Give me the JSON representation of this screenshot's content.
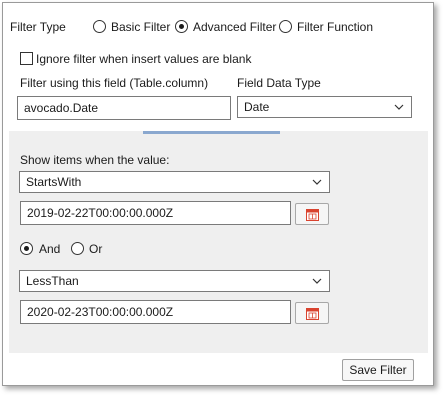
{
  "filter_type": {
    "label": "Filter Type",
    "options": [
      "Basic Filter",
      "Advanced Filter",
      "Filter Function"
    ],
    "selected": "Advanced Filter"
  },
  "ignore_blank": {
    "label": "Ignore filter when insert values are blank",
    "checked": false
  },
  "field": {
    "label": "Filter using this field (Table.column)",
    "value": "avocado.Date"
  },
  "data_type": {
    "label": "Field Data Type",
    "value": "Date"
  },
  "conditions": {
    "label": "Show items when the value:",
    "first_operator": "StartsWith",
    "first_value": "2019-02-22T00:00:00.000Z",
    "logic_options": [
      "And",
      "Or"
    ],
    "logic_selected": "And",
    "second_operator": "LessThan",
    "second_value": "2020-02-23T00:00:00.000Z"
  },
  "save_button": "Save Filter",
  "icons": {
    "dropdown": "chevron-down-icon",
    "calendar": "calendar-icon"
  },
  "colors": {
    "accent": "#8aa8cf",
    "panel": "#efefef",
    "calendar_red": "#d9432f"
  }
}
